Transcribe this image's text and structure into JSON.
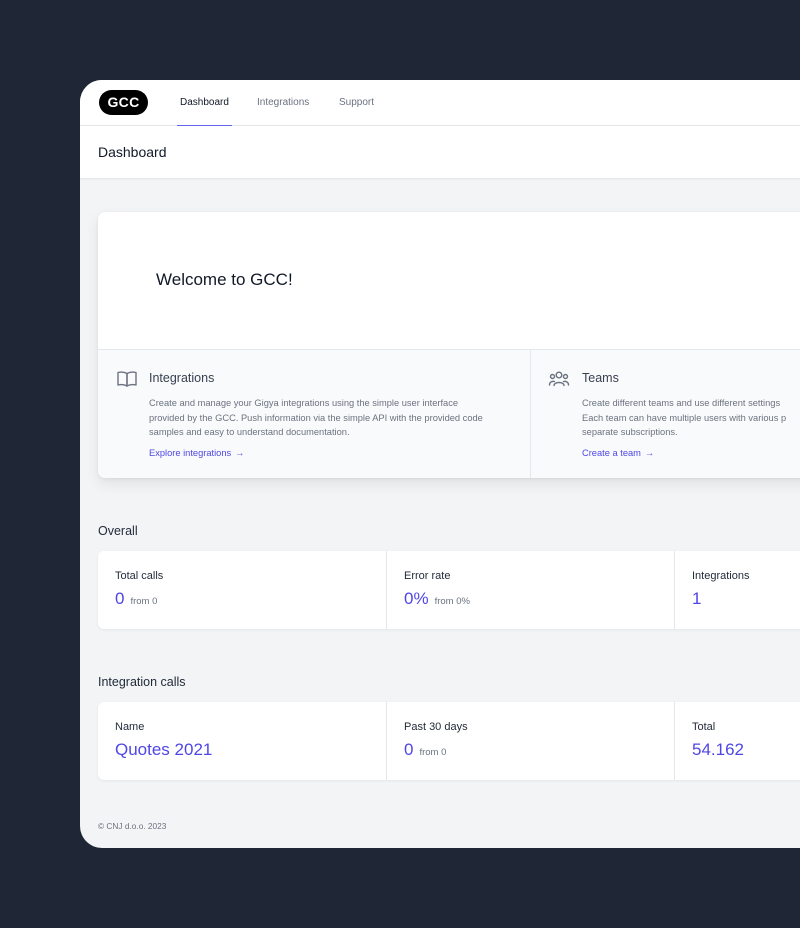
{
  "app": {
    "logo": "GCC"
  },
  "nav": {
    "tabs": [
      {
        "label": "Dashboard",
        "active": true
      },
      {
        "label": "Integrations"
      },
      {
        "label": "Support"
      }
    ]
  },
  "header": {
    "title": "Dashboard"
  },
  "welcome": {
    "title": "Welcome to GCC!",
    "features": [
      {
        "icon": "book-icon",
        "title": "Integrations",
        "description_lines": [
          "Create and manage your Gigya integrations using the simple user interface",
          "provided by the GCC. Push information via the simple API with the provided code",
          "samples and easy to understand documentation."
        ],
        "link": "Explore integrations",
        "link_arrow": "→"
      },
      {
        "icon": "users-icon",
        "title": "Teams",
        "description_lines": [
          "Create different teams and use different settings",
          "Each team can have multiple users with various p",
          "separate subscriptions."
        ],
        "link": "Create a team",
        "link_arrow": "→"
      }
    ]
  },
  "overall": {
    "title": "Overall",
    "stats": [
      {
        "label": "Total calls",
        "value": "0",
        "from": "from 0"
      },
      {
        "label": "Error rate",
        "value": "0%",
        "from": "from 0%"
      },
      {
        "label": "Integrations",
        "value": "1",
        "from": ""
      }
    ]
  },
  "integration_calls": {
    "title": "Integration calls",
    "stats": [
      {
        "label": "Name",
        "value": "Quotes 2021",
        "from": ""
      },
      {
        "label": "Past 30 days",
        "value": "0",
        "from": "from 0"
      },
      {
        "label": "Total",
        "value": "54.162",
        "from": ""
      }
    ]
  },
  "footer": {
    "copyright": "© CNJ d.o.o. 2023"
  },
  "colors": {
    "accent": "#4f46e5",
    "background": "#1f2736",
    "page": "#f3f4f6"
  }
}
